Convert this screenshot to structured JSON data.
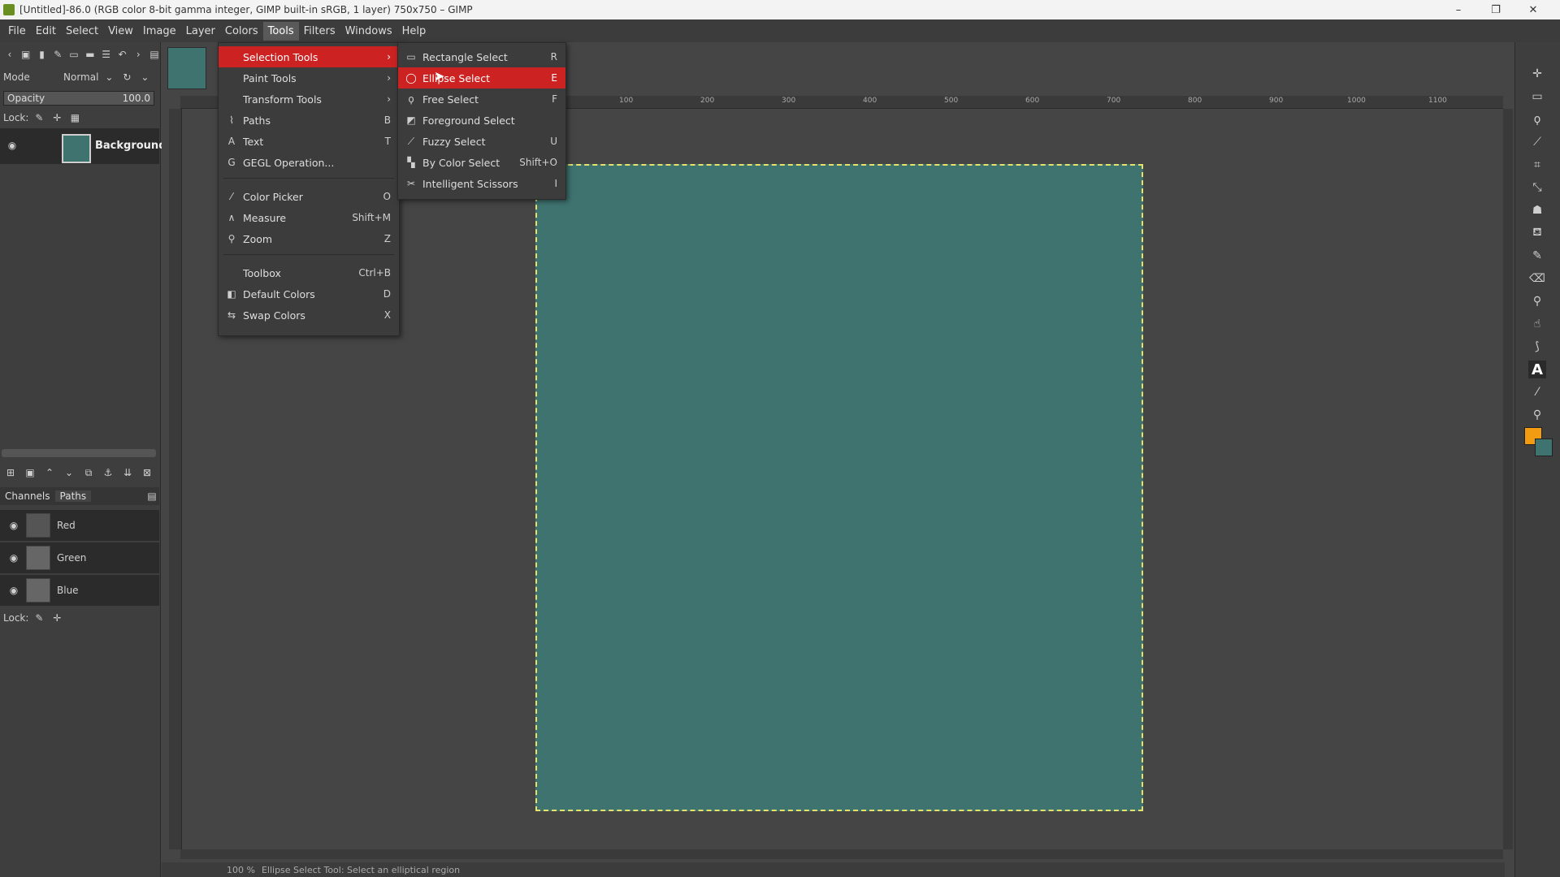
{
  "window": {
    "title": "[Untitled]-86.0 (RGB color 8-bit gamma integer, GIMP built-in sRGB, 1 layer) 750x750 – GIMP",
    "minimize": "–",
    "restore": "❐",
    "close": "✕"
  },
  "menubar": [
    "File",
    "Edit",
    "Select",
    "View",
    "Image",
    "Layer",
    "Colors",
    "Tools",
    "Filters",
    "Windows",
    "Help"
  ],
  "layers": {
    "mode_label": "Mode",
    "mode_value": "Normal",
    "opacity_label": "Opacity",
    "opacity_value": "100.0",
    "lock_label": "Lock:",
    "layer_name": "Background"
  },
  "channels": {
    "tab_channels": "Channels",
    "tab_paths": "Paths",
    "items": [
      "Red",
      "Green",
      "Blue"
    ],
    "lock_label": "Lock:"
  },
  "tools_menu": [
    {
      "label": "Selection Tools",
      "shortcut": "",
      "icon": "",
      "submenu": true
    },
    {
      "label": "Paint Tools",
      "shortcut": "",
      "icon": "",
      "submenu": true
    },
    {
      "label": "Transform Tools",
      "shortcut": "",
      "icon": "",
      "submenu": true
    },
    {
      "label": "Paths",
      "shortcut": "B",
      "icon": "paths-icon"
    },
    {
      "label": "Text",
      "shortcut": "T",
      "icon": "text-icon"
    },
    {
      "label": "GEGL Operation...",
      "shortcut": "",
      "icon": "gegl-icon"
    },
    {
      "label": "Color Picker",
      "shortcut": "O",
      "icon": "color-picker-icon"
    },
    {
      "label": "Measure",
      "shortcut": "Shift+M",
      "icon": "measure-icon"
    },
    {
      "label": "Zoom",
      "shortcut": "Z",
      "icon": "zoom-icon"
    },
    {
      "label": "Toolbox",
      "shortcut": "Ctrl+B",
      "icon": ""
    },
    {
      "label": "Default Colors",
      "shortcut": "D",
      "icon": "default-colors-icon"
    },
    {
      "label": "Swap Colors",
      "shortcut": "X",
      "icon": "swap-colors-icon"
    }
  ],
  "selection_submenu": [
    {
      "label": "Rectangle Select",
      "shortcut": "R",
      "icon": "rectangle-select-icon"
    },
    {
      "label": "Ellipse Select",
      "shortcut": "E",
      "icon": "ellipse-select-icon"
    },
    {
      "label": "Free Select",
      "shortcut": "F",
      "icon": "free-select-icon"
    },
    {
      "label": "Foreground Select",
      "shortcut": "",
      "icon": "foreground-select-icon"
    },
    {
      "label": "Fuzzy Select",
      "shortcut": "U",
      "icon": "fuzzy-select-icon"
    },
    {
      "label": "By Color Select",
      "shortcut": "Shift+O",
      "icon": "by-color-select-icon"
    },
    {
      "label": "Intelligent Scissors",
      "shortcut": "I",
      "icon": "intelligent-scissors-icon"
    }
  ],
  "ruler_ticks": [
    "100",
    "200",
    "300",
    "400",
    "500",
    "600",
    "700",
    "800",
    "900",
    "1000",
    "1100"
  ],
  "statusbar": {
    "zoom": "100 %",
    "message": "Ellipse Select Tool: Select an elliptical region"
  },
  "colors": {
    "foreground": "#f39c12",
    "background": "#3f7370",
    "canvas_fill": "#3f7370",
    "menu_highlight": "#cc2222"
  }
}
